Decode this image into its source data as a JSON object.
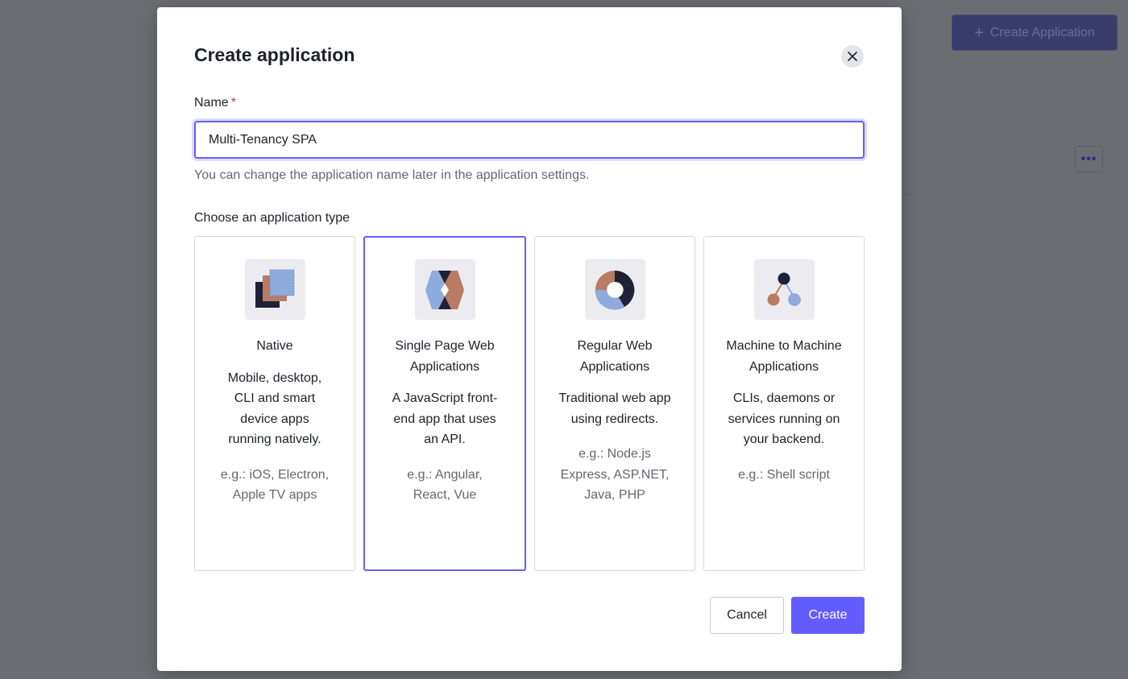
{
  "background": {
    "create_application_label": "Create Application",
    "more_label": "•••"
  },
  "modal": {
    "title": "Create application",
    "name_label": "Name",
    "required_marker": "*",
    "name_value": "Multi-Tenancy SPA",
    "helper_text": "You can change the application name later in the application settings.",
    "type_label": "Choose an application type",
    "cards": [
      {
        "icon": "native-icon",
        "title": "Native",
        "description": "Mobile, desktop, CLI and smart device apps running natively.",
        "example": "e.g.: iOS, Electron, Apple TV apps",
        "selected": false
      },
      {
        "icon": "spa-icon",
        "title": "Single Page Web Applications",
        "description": "A JavaScript front-end app that uses an API.",
        "example": "e.g.: Angular, React, Vue",
        "selected": true
      },
      {
        "icon": "regular-web-icon",
        "title": "Regular Web Applications",
        "description": "Traditional web app using redirects.",
        "example": "e.g.: Node.js Express, ASP.NET, Java, PHP",
        "selected": false
      },
      {
        "icon": "machine-to-machine-icon",
        "title": "Machine to Machine Applications",
        "description": "CLIs, daemons or services running on your backend.",
        "example": "e.g.: Shell script",
        "selected": false
      }
    ],
    "cancel_label": "Cancel",
    "create_label": "Create"
  },
  "colors": {
    "accent": "#635dff",
    "overlay": "#6b6d72",
    "text_primary": "#1e212a",
    "text_secondary": "#65676e",
    "icon_dark": "#1f2137",
    "icon_copper": "#b97b63",
    "icon_blue": "#8fabdc"
  }
}
